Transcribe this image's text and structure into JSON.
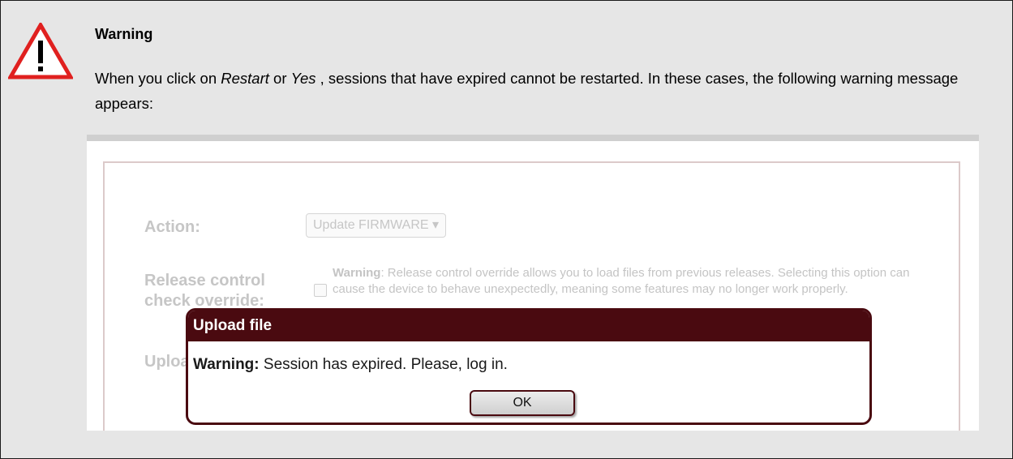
{
  "note": {
    "title": "Warning",
    "text_before_restart": "When you click on ",
    "restart": "Restart",
    "text_or": " or ",
    "yes": "Yes",
    "text_after": " , sessions that have expired cannot be restarted. In these cases, the following warning message appears:",
    "icon": "warning-triangle-icon",
    "icon_color": "#e0201f"
  },
  "screenshot": {
    "action_label": "Action:",
    "action_value": "Update FIRMWARE ▾",
    "release_label_line1": "Release control",
    "release_label_line2": "check override:",
    "help_bold": "Warning",
    "help_text": ": Release control override allows you to load files from previous releases. Selecting this option can cause the device to behave unexpectedly, meaning some features may no longer work properly.",
    "upload_label_partial": "Uploa",
    "dialog": {
      "title": "Upload file",
      "msg_bold": "Warning:",
      "msg_text": " Session has expired. Please, log in.",
      "ok": "OK"
    },
    "colors": {
      "dialog_header": "#4a0a10"
    }
  }
}
